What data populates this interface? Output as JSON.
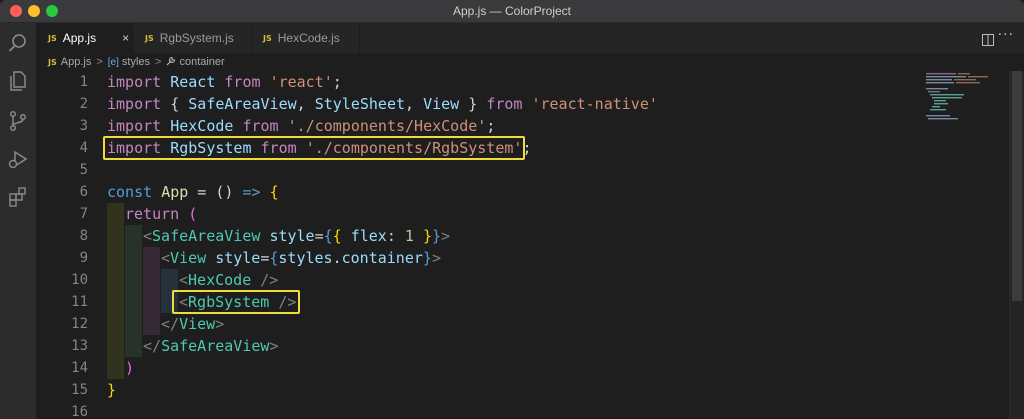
{
  "window": {
    "title": "App.js — ColorProject"
  },
  "tabs": [
    {
      "icon_text": "JS",
      "label": "App.js",
      "active": true,
      "close": "×"
    },
    {
      "icon_text": "JS",
      "label": "RgbSystem.js",
      "active": false
    },
    {
      "icon_text": "JS",
      "label": "HexCode.js",
      "active": false
    }
  ],
  "breadcrumb": {
    "file_icon": "JS",
    "file": "App.js",
    "sep": ">",
    "sym1_icon": "[e]",
    "sym1": "styles",
    "sym2": "container"
  },
  "editor": {
    "line_numbers": [
      "1",
      "2",
      "3",
      "4",
      "5",
      "6",
      "7",
      "8",
      "9",
      "10",
      "11",
      "12",
      "13",
      "14",
      "15",
      "16"
    ],
    "highlighted_lines": [
      4,
      11
    ],
    "tokens": {
      "l1": [
        "import",
        " ",
        "React",
        " ",
        "from",
        " ",
        "'react'",
        ";"
      ],
      "l2": [
        "import",
        " { ",
        "SafeAreaView",
        ", ",
        "StyleSheet",
        ", ",
        "View",
        " } ",
        "from",
        " ",
        "'react-native'"
      ],
      "l3": [
        "import",
        " ",
        "HexCode",
        " ",
        "from",
        " ",
        "'./components/HexCode'",
        ";"
      ],
      "l4": [
        "import",
        " ",
        "RgbSystem",
        " ",
        "from",
        " ",
        "'./components/RgbSystem'",
        ";"
      ],
      "l6": [
        "const",
        " ",
        "App",
        " = () ",
        "=>",
        " ",
        "{"
      ],
      "l7": [
        "return",
        " ",
        "("
      ],
      "l8": [
        "<",
        "SafeAreaView",
        " ",
        "style",
        "=",
        "{",
        "{",
        " ",
        "flex",
        ": ",
        "1",
        " ",
        "}",
        "}",
        ">"
      ],
      "l9": [
        "<",
        "View",
        " ",
        "style",
        "=",
        "{",
        "styles",
        ".",
        "container",
        "}",
        ">"
      ],
      "l10": [
        "<",
        "HexCode",
        " ",
        "/>"
      ],
      "l11": [
        "<",
        "RgbSystem",
        " ",
        "/>"
      ],
      "l12": [
        "</",
        "View",
        ">"
      ],
      "l13": [
        "</",
        "SafeAreaView",
        ">"
      ],
      "l14": [
        ")"
      ],
      "l15": [
        "}"
      ]
    }
  }
}
